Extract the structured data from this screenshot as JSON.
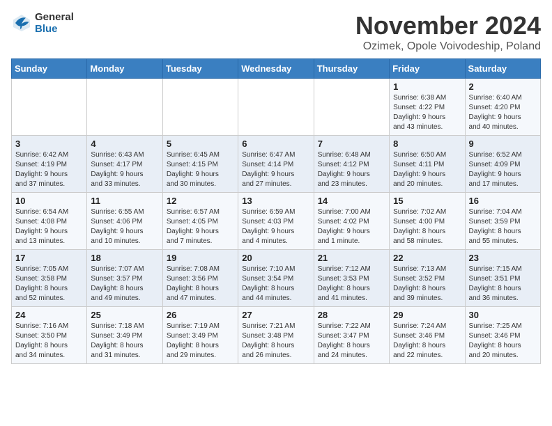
{
  "header": {
    "logo_line1": "General",
    "logo_line2": "Blue",
    "month_title": "November 2024",
    "subtitle": "Ozimek, Opole Voivodeship, Poland"
  },
  "weekdays": [
    "Sunday",
    "Monday",
    "Tuesday",
    "Wednesday",
    "Thursday",
    "Friday",
    "Saturday"
  ],
  "weeks": [
    [
      {
        "day": "",
        "info": ""
      },
      {
        "day": "",
        "info": ""
      },
      {
        "day": "",
        "info": ""
      },
      {
        "day": "",
        "info": ""
      },
      {
        "day": "",
        "info": ""
      },
      {
        "day": "1",
        "info": "Sunrise: 6:38 AM\nSunset: 4:22 PM\nDaylight: 9 hours\nand 43 minutes."
      },
      {
        "day": "2",
        "info": "Sunrise: 6:40 AM\nSunset: 4:20 PM\nDaylight: 9 hours\nand 40 minutes."
      }
    ],
    [
      {
        "day": "3",
        "info": "Sunrise: 6:42 AM\nSunset: 4:19 PM\nDaylight: 9 hours\nand 37 minutes."
      },
      {
        "day": "4",
        "info": "Sunrise: 6:43 AM\nSunset: 4:17 PM\nDaylight: 9 hours\nand 33 minutes."
      },
      {
        "day": "5",
        "info": "Sunrise: 6:45 AM\nSunset: 4:15 PM\nDaylight: 9 hours\nand 30 minutes."
      },
      {
        "day": "6",
        "info": "Sunrise: 6:47 AM\nSunset: 4:14 PM\nDaylight: 9 hours\nand 27 minutes."
      },
      {
        "day": "7",
        "info": "Sunrise: 6:48 AM\nSunset: 4:12 PM\nDaylight: 9 hours\nand 23 minutes."
      },
      {
        "day": "8",
        "info": "Sunrise: 6:50 AM\nSunset: 4:11 PM\nDaylight: 9 hours\nand 20 minutes."
      },
      {
        "day": "9",
        "info": "Sunrise: 6:52 AM\nSunset: 4:09 PM\nDaylight: 9 hours\nand 17 minutes."
      }
    ],
    [
      {
        "day": "10",
        "info": "Sunrise: 6:54 AM\nSunset: 4:08 PM\nDaylight: 9 hours\nand 13 minutes."
      },
      {
        "day": "11",
        "info": "Sunrise: 6:55 AM\nSunset: 4:06 PM\nDaylight: 9 hours\nand 10 minutes."
      },
      {
        "day": "12",
        "info": "Sunrise: 6:57 AM\nSunset: 4:05 PM\nDaylight: 9 hours\nand 7 minutes."
      },
      {
        "day": "13",
        "info": "Sunrise: 6:59 AM\nSunset: 4:03 PM\nDaylight: 9 hours\nand 4 minutes."
      },
      {
        "day": "14",
        "info": "Sunrise: 7:00 AM\nSunset: 4:02 PM\nDaylight: 9 hours\nand 1 minute."
      },
      {
        "day": "15",
        "info": "Sunrise: 7:02 AM\nSunset: 4:00 PM\nDaylight: 8 hours\nand 58 minutes."
      },
      {
        "day": "16",
        "info": "Sunrise: 7:04 AM\nSunset: 3:59 PM\nDaylight: 8 hours\nand 55 minutes."
      }
    ],
    [
      {
        "day": "17",
        "info": "Sunrise: 7:05 AM\nSunset: 3:58 PM\nDaylight: 8 hours\nand 52 minutes."
      },
      {
        "day": "18",
        "info": "Sunrise: 7:07 AM\nSunset: 3:57 PM\nDaylight: 8 hours\nand 49 minutes."
      },
      {
        "day": "19",
        "info": "Sunrise: 7:08 AM\nSunset: 3:56 PM\nDaylight: 8 hours\nand 47 minutes."
      },
      {
        "day": "20",
        "info": "Sunrise: 7:10 AM\nSunset: 3:54 PM\nDaylight: 8 hours\nand 44 minutes."
      },
      {
        "day": "21",
        "info": "Sunrise: 7:12 AM\nSunset: 3:53 PM\nDaylight: 8 hours\nand 41 minutes."
      },
      {
        "day": "22",
        "info": "Sunrise: 7:13 AM\nSunset: 3:52 PM\nDaylight: 8 hours\nand 39 minutes."
      },
      {
        "day": "23",
        "info": "Sunrise: 7:15 AM\nSunset: 3:51 PM\nDaylight: 8 hours\nand 36 minutes."
      }
    ],
    [
      {
        "day": "24",
        "info": "Sunrise: 7:16 AM\nSunset: 3:50 PM\nDaylight: 8 hours\nand 34 minutes."
      },
      {
        "day": "25",
        "info": "Sunrise: 7:18 AM\nSunset: 3:49 PM\nDaylight: 8 hours\nand 31 minutes."
      },
      {
        "day": "26",
        "info": "Sunrise: 7:19 AM\nSunset: 3:49 PM\nDaylight: 8 hours\nand 29 minutes."
      },
      {
        "day": "27",
        "info": "Sunrise: 7:21 AM\nSunset: 3:48 PM\nDaylight: 8 hours\nand 26 minutes."
      },
      {
        "day": "28",
        "info": "Sunrise: 7:22 AM\nSunset: 3:47 PM\nDaylight: 8 hours\nand 24 minutes."
      },
      {
        "day": "29",
        "info": "Sunrise: 7:24 AM\nSunset: 3:46 PM\nDaylight: 8 hours\nand 22 minutes."
      },
      {
        "day": "30",
        "info": "Sunrise: 7:25 AM\nSunset: 3:46 PM\nDaylight: 8 hours\nand 20 minutes."
      }
    ]
  ]
}
